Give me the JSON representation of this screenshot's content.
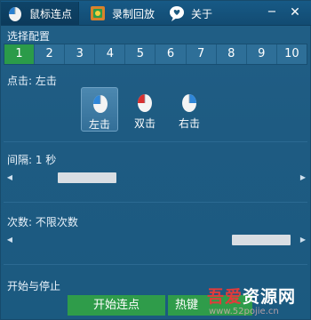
{
  "tabs": [
    {
      "label": "鼠标连点",
      "icon": "mouse-logo-icon",
      "active": true
    },
    {
      "label": "录制回放",
      "icon": "record-playback-icon",
      "active": false
    },
    {
      "label": "关于",
      "icon": "speech-bubble-heart-icon",
      "active": false
    }
  ],
  "window_controls": {
    "minimize": "−",
    "close": "✕"
  },
  "config": {
    "label": "选择配置",
    "options": [
      "1",
      "2",
      "3",
      "4",
      "5",
      "6",
      "7",
      "8",
      "9",
      "10"
    ],
    "selected": "1"
  },
  "click": {
    "label": "点击: 左击",
    "options": [
      {
        "label": "左击",
        "icon": "mouse-left-button-icon",
        "selected": true
      },
      {
        "label": "双击",
        "icon": "mouse-double-click-icon",
        "selected": false
      },
      {
        "label": "右击",
        "icon": "mouse-right-button-icon",
        "selected": false
      }
    ]
  },
  "interval": {
    "label": "间隔: 1 秒"
  },
  "count": {
    "label": "次数: 不限次数"
  },
  "startstop": {
    "label": "开始与停止",
    "start_button": "开始连点",
    "hotkey_button": "热键"
  },
  "watermark": {
    "main_red": "吾爱",
    "main_white": "资源网",
    "sub": "www.52pojie.cn"
  },
  "colors": {
    "accent_green": "#2f9c4a",
    "background": "#1e5b82",
    "selected_tab": "#0e4468"
  }
}
